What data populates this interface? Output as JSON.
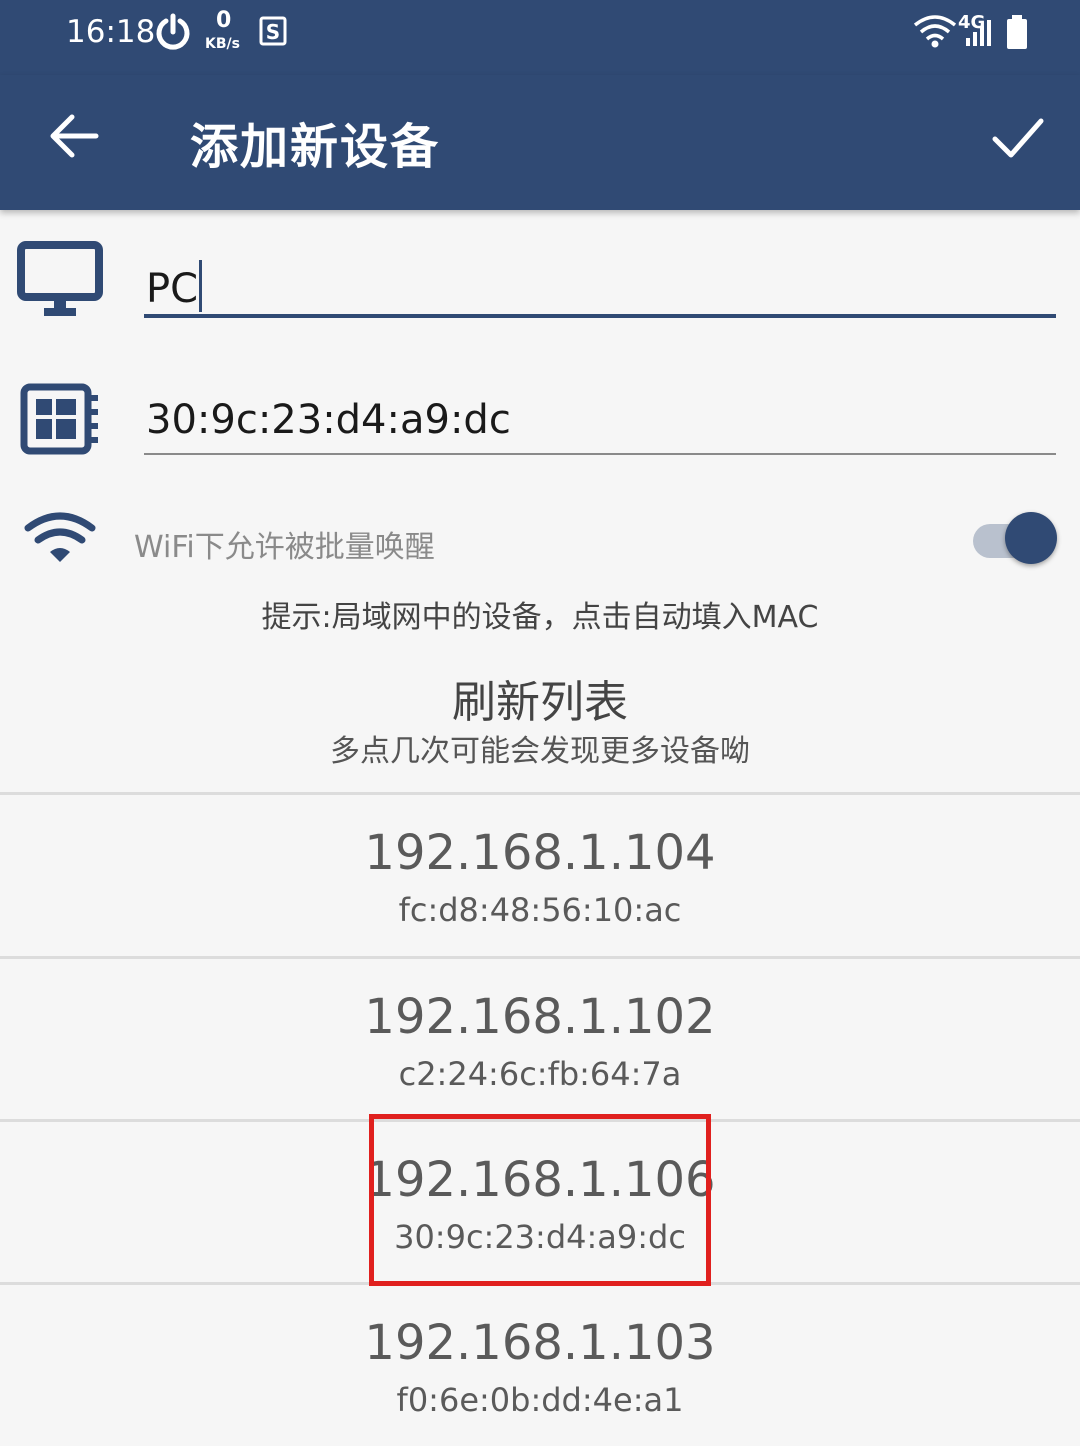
{
  "status_bar": {
    "time": "16:18",
    "net_speed_value": "0",
    "net_speed_unit": "KB/s",
    "network_type": "4G",
    "icons": [
      "power-icon",
      "sim-s-icon",
      "wifi-icon",
      "signal-icon",
      "battery-icon"
    ]
  },
  "app_bar": {
    "title": "添加新设备",
    "back_icon": "arrow-back-icon",
    "confirm_icon": "check-icon"
  },
  "form": {
    "name_value": "PC",
    "name_icon": "monitor-icon",
    "mac_value": "30:9c:23:d4:a9:dc",
    "mac_icon": "chip-icon",
    "wifi_wake_label": "WiFi下允许被批量唤醒",
    "wifi_wake_enabled": true,
    "wifi_icon": "wifi-icon"
  },
  "hint_text": "提示:局域网中的设备，点击自动填入MAC",
  "refresh": {
    "label": "刷新列表",
    "sub_label": "多点几次可能会发现更多设备呦"
  },
  "devices": [
    {
      "ip": "192.168.1.104",
      "mac": "fc:d8:48:56:10:ac"
    },
    {
      "ip": "192.168.1.102",
      "mac": "c2:24:6c:fb:64:7a"
    },
    {
      "ip": "192.168.1.106",
      "mac": "30:9c:23:d4:a9:dc",
      "highlighted": true
    },
    {
      "ip": "192.168.1.103",
      "mac": "f0:6e:0b:dd:4e:a1"
    }
  ],
  "colors": {
    "primary": "#304a74",
    "highlight": "#e0201e",
    "background": "#f6f6f6"
  }
}
